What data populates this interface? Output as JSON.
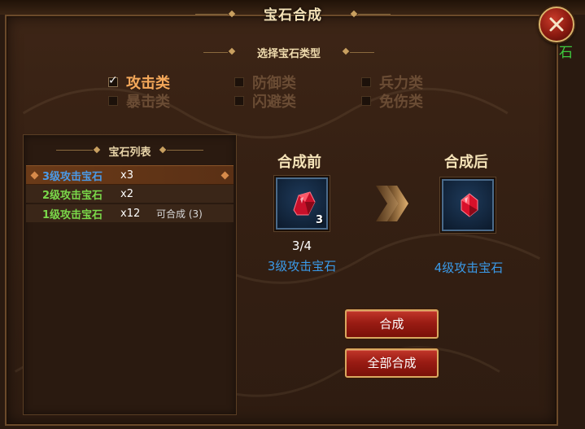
{
  "window": {
    "title": "宝石合成",
    "close_icon": "close-x-icon",
    "side_text": "石"
  },
  "category_section": {
    "title": "选择宝石类型",
    "items": [
      {
        "label": "攻击类",
        "checked": true
      },
      {
        "label": "防御类",
        "checked": false
      },
      {
        "label": "兵力类",
        "checked": false
      },
      {
        "label": "暴击类",
        "checked": false
      },
      {
        "label": "闪避类",
        "checked": false
      },
      {
        "label": "免伤类",
        "checked": false
      }
    ]
  },
  "gem_list": {
    "title": "宝石列表",
    "rows": [
      {
        "name": "3级攻击宝石",
        "qty": "x3",
        "note": "",
        "selected": true,
        "color": "#4a9ae8"
      },
      {
        "name": "2级攻击宝石",
        "qty": "x2",
        "note": "",
        "selected": false,
        "color": "#7ad84a"
      },
      {
        "name": "1级攻击宝石",
        "qty": "x12",
        "note": "可合成 (3)",
        "selected": false,
        "color": "#7ad84a"
      }
    ]
  },
  "synthesis": {
    "before_label": "合成前",
    "after_label": "合成后",
    "before_count_badge": "3",
    "before_progress": "3/4",
    "before_name": "3级攻击宝石",
    "after_name": "4级攻击宝石",
    "gem_icon": "red-gem-icon",
    "arrow_icon": "double-chevron-right-icon",
    "name_color": "#3a9ae8"
  },
  "buttons": {
    "combine": "合成",
    "combine_all": "全部合成"
  }
}
